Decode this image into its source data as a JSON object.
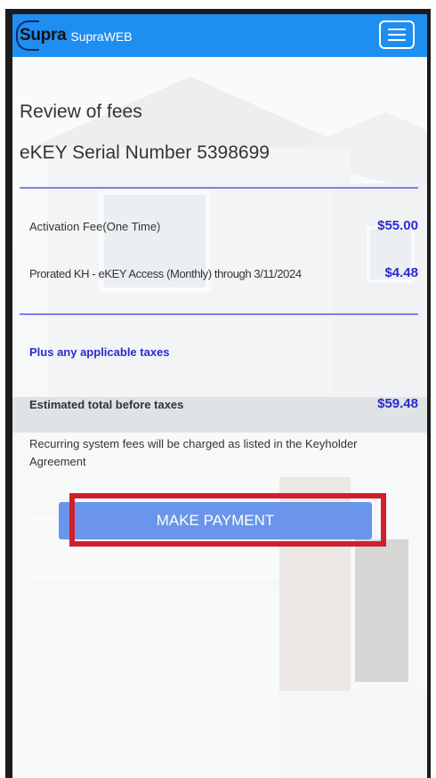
{
  "header": {
    "logo": "Supra",
    "brand": "SupraWEB",
    "menu_icon": "hamburger-menu-icon",
    "bg_color": "#1f8ef1"
  },
  "review": {
    "title": "Review of fees",
    "serial": "eKEY Serial Number 5398699"
  },
  "fees": [
    {
      "label": "Activation Fee(One Time)",
      "amount": "$55.00"
    },
    {
      "label": "Prorated KH - eKEY Access (Monthly) through 3/11/2024",
      "amount": "$4.48"
    }
  ],
  "taxes_note": "Plus any applicable taxes",
  "total": {
    "label": "Estimated total before taxes",
    "amount": "$59.48"
  },
  "recurring_note": "Recurring system fees will be charged as listed in the Keyholder Agreement",
  "payment_button": {
    "label": "MAKE PAYMENT",
    "color": "#6b95ea"
  },
  "colors": {
    "accent_blue": "#2a2ad0",
    "divider": "#7d7ff0",
    "highlight": "#d21f2c"
  }
}
